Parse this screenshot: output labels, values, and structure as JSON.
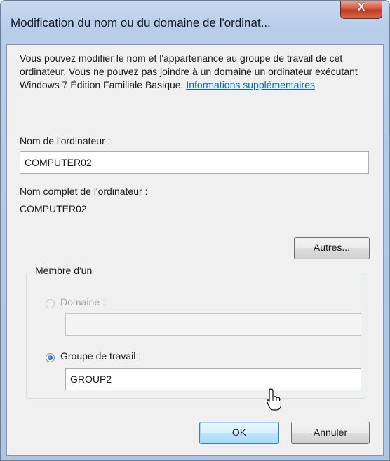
{
  "window": {
    "title": "Modification du nom ou du domaine de l'ordinat...",
    "close_glyph": "X"
  },
  "description": {
    "text": "Vous pouvez modifier le nom et l'appartenance au groupe de travail de cet ordinateur. Vous ne pouvez pas joindre à un domaine un ordinateur exécutant Windows 7 Édition Familiale Basique. ",
    "link": "Informations supplémentaires"
  },
  "computer_name": {
    "label": "Nom de l'ordinateur :",
    "value": "COMPUTER02"
  },
  "full_name": {
    "label": "Nom complet de l'ordinateur :",
    "value": "COMPUTER02"
  },
  "more_button": "Autres...",
  "member_of": {
    "title": "Membre d'un",
    "domain_label": "Domaine :",
    "domain_value": "",
    "domain_enabled": false,
    "workgroup_label": "Groupe de travail :",
    "workgroup_value": "GROUP2",
    "selected": "workgroup"
  },
  "buttons": {
    "ok": "OK",
    "cancel": "Annuler"
  }
}
